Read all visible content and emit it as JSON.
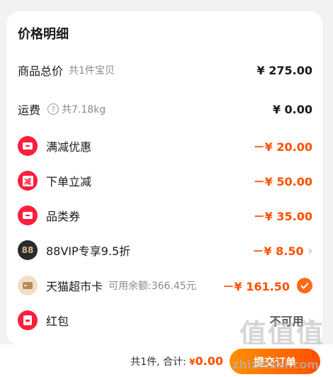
{
  "title": "价格明细",
  "rows": [
    {
      "label": "商品总价",
      "sub": "共1件宝贝",
      "value": "¥ 275.00"
    },
    {
      "label": "运费",
      "sub": "共7.18kg",
      "value": "¥ 0.00"
    },
    {
      "label": "满减优惠",
      "value": "－¥ 20.00"
    },
    {
      "label": "下单立减",
      "icon_text": "减",
      "value": "－¥ 50.00"
    },
    {
      "label": "品类券",
      "value": "－¥ 35.00"
    },
    {
      "label": "88VIP专享9.5折",
      "icon_text": "88",
      "value": "－¥ 8.50"
    },
    {
      "label": "天猫超市卡",
      "sub": "可用余额:366.45元",
      "value": "－¥ 161.50"
    },
    {
      "label": "红包",
      "value": "不可用"
    }
  ],
  "footer": {
    "count": "共1件,",
    "total_label": "合计:",
    "currency": "¥",
    "total": "0.00",
    "submit": "提交订单"
  },
  "watermark": {
    "text": "值值值",
    "url": "zhizhizhi.com"
  },
  "colors": {
    "accent": "#ff5000",
    "icon_red": "#ff1e3c",
    "check": "#ff6a1a"
  }
}
